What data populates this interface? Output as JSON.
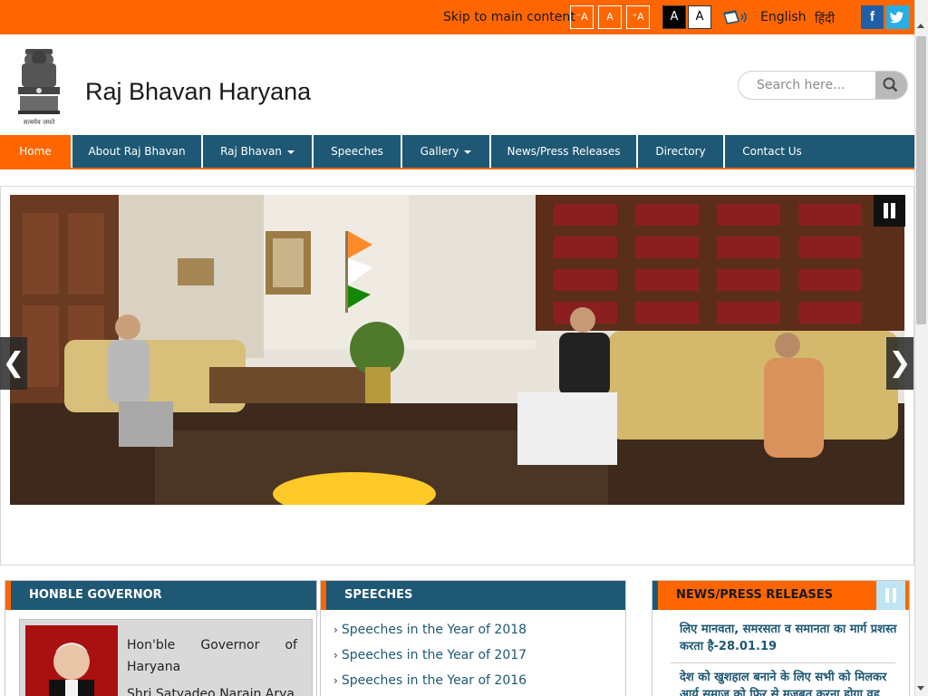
{
  "topbar": {
    "skip_link": "Skip to main content",
    "font_decrease": "⁻A",
    "font_normal": "A",
    "font_increase": "⁺A",
    "contrast_dark": "A",
    "contrast_light": "A",
    "lang_english": "English",
    "lang_hindi": "हिंदी",
    "facebook": "f",
    "twitter_icon": "twitter-icon"
  },
  "header": {
    "title": "Raj Bhavan Haryana",
    "emblem_motto": "सत्यमेव जयते",
    "search_placeholder": "Search here..."
  },
  "nav": {
    "items": [
      {
        "label": "Home"
      },
      {
        "label": "About Raj Bhavan"
      },
      {
        "label": "Raj Bhavan"
      },
      {
        "label": "Speeches"
      },
      {
        "label": "Gallery"
      },
      {
        "label": "News/Press Releases"
      },
      {
        "label": "Directory"
      },
      {
        "label": "Contact Us"
      }
    ]
  },
  "slider": {
    "prev": "❮",
    "next": "❯"
  },
  "governor_panel": {
    "heading": "HONBLE GOVERNOR",
    "title": "Hon'ble Governor of Haryana",
    "name": "Shri Satyadeo Narain Arya"
  },
  "speeches_panel": {
    "heading": "SPEECHES",
    "links": [
      "Speeches in the Year of 2018",
      "Speeches in the Year of 2017",
      "Speeches in the Year of 2016"
    ]
  },
  "news_panel": {
    "heading": "NEWS/PRESS RELEASES",
    "items": [
      "लिए मानवता, समरसता व समानता का मार्ग प्रशस्त करता है-28.01.19",
      "देश को खुशहाल बनाने के लिए सभी को मिलकर आर्य समाज को फिर से मजबूत करना होगा वह"
    ]
  },
  "colors": {
    "accent_orange": "#ff6600",
    "nav_blue": "#1e5874"
  }
}
